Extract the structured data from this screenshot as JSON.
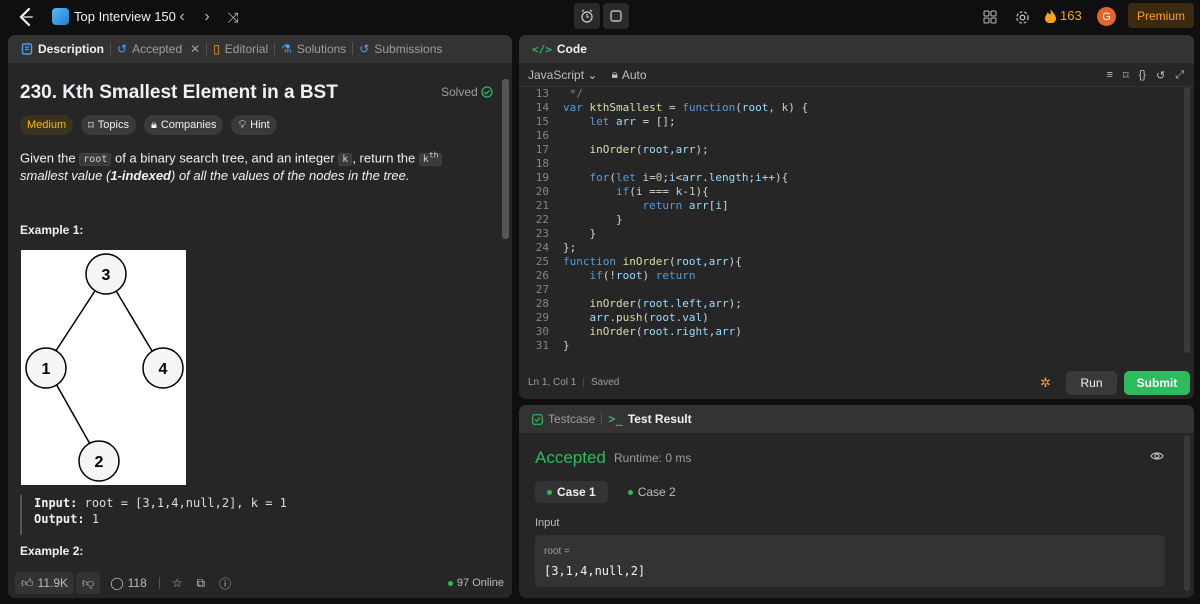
{
  "topbar": {
    "list_title": "Top Interview 150",
    "streak": "163",
    "avatar_initial": "G",
    "premium_label": "Premium"
  },
  "left_tabs": [
    {
      "label": "Description",
      "icon": "doc-icon"
    },
    {
      "label": "Accepted",
      "icon": "history-icon"
    },
    {
      "label": "Editorial",
      "icon": "book-icon"
    },
    {
      "label": "Solutions",
      "icon": "flask-icon"
    },
    {
      "label": "Submissions",
      "icon": "history-icon"
    }
  ],
  "problem": {
    "title": "230. Kth Smallest Element in a BST",
    "status": "Solved",
    "difficulty": "Medium",
    "topics_label": "Topics",
    "companies_label": "Companies",
    "hint_label": "Hint",
    "desc_1": "Given the ",
    "desc_code_root": "root",
    "desc_2": " of a binary search tree, and an integer ",
    "desc_code_k": "k",
    "desc_3": ", return the ",
    "desc_kth_code": "k",
    "desc_kth_sup": "th",
    "desc_4": " smallest value (",
    "desc_bold": "1-indexed",
    "desc_5": ") of all the values of the nodes in the tree.",
    "example1_title": "Example 1:",
    "example2_title": "Example 2:",
    "tree_nodes": [
      "3",
      "1",
      "4",
      "2"
    ],
    "input_label": "Input:",
    "input_value": "root = [3,1,4,null,2], k = 1",
    "output_label": "Output:",
    "output_value": "1"
  },
  "footer_left": {
    "likes": "11.9K",
    "comments": "118",
    "online": "97 Online"
  },
  "code_panel": {
    "title": "Code",
    "language": "JavaScript",
    "mode": "Auto",
    "status_pos": "Ln 1, Col 1",
    "status_saved": "Saved",
    "run_label": "Run",
    "submit_label": "Submit",
    "lines": [
      {
        "n": "13",
        "t": " */"
      },
      {
        "n": "14",
        "t": "var kthSmallest = function(root, k) {"
      },
      {
        "n": "15",
        "t": "    let arr = [];"
      },
      {
        "n": "16",
        "t": ""
      },
      {
        "n": "17",
        "t": "    inOrder(root,arr);"
      },
      {
        "n": "18",
        "t": ""
      },
      {
        "n": "19",
        "t": "    for(let i=0;i<arr.length;i++){"
      },
      {
        "n": "20",
        "t": "        if(i === k-1){"
      },
      {
        "n": "21",
        "t": "            return arr[i]"
      },
      {
        "n": "22",
        "t": "        }"
      },
      {
        "n": "23",
        "t": "    }"
      },
      {
        "n": "24",
        "t": "};"
      },
      {
        "n": "25",
        "t": "function inOrder(root,arr){"
      },
      {
        "n": "26",
        "t": "    if(!root) return"
      },
      {
        "n": "27",
        "t": ""
      },
      {
        "n": "28",
        "t": "    inOrder(root.left,arr);"
      },
      {
        "n": "29",
        "t": "    arr.push(root.val)"
      },
      {
        "n": "30",
        "t": "    inOrder(root.right,arr)"
      },
      {
        "n": "31",
        "t": "}"
      }
    ]
  },
  "result_panel": {
    "testcase_label": "Testcase",
    "result_label": "Test Result",
    "verdict": "Accepted",
    "runtime": "Runtime: 0 ms",
    "cases": [
      "Case 1",
      "Case 2"
    ],
    "input_label": "Input",
    "input_name": "root =",
    "input_value": "[3,1,4,null,2]"
  },
  "colors": {
    "accent": "#ffa116",
    "accepted": "#2cbb5d",
    "medium": "#ffb800"
  }
}
